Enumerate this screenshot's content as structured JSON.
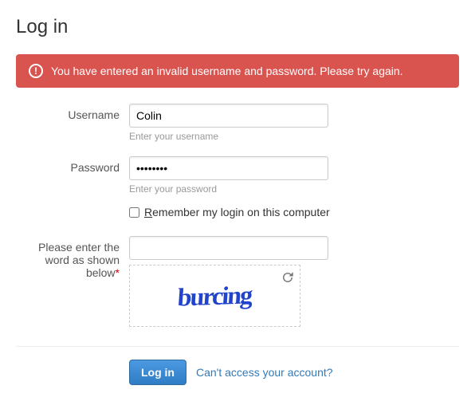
{
  "title": "Log in",
  "alert": {
    "icon": "!",
    "message": "You have entered an invalid username and password. Please try again."
  },
  "form": {
    "username": {
      "label": "Username",
      "value": "Colin",
      "hint": "Enter your username"
    },
    "password": {
      "label": "Password",
      "value": "••••••••",
      "hint": "Enter your password"
    },
    "remember": {
      "label": "Remember my login on this computer",
      "checked": false
    },
    "captcha": {
      "label": "Please enter the word as shown below",
      "value": "",
      "word": "burcing"
    }
  },
  "actions": {
    "login": "Log in",
    "forgot": "Can't access your account?"
  }
}
